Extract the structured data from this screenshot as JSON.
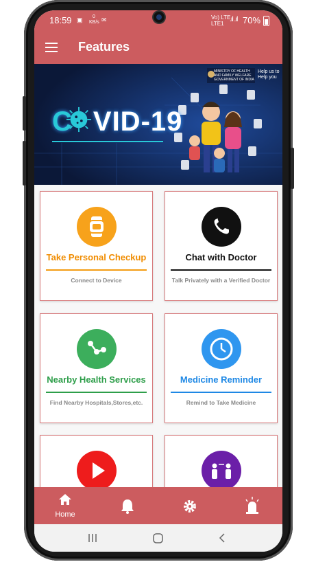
{
  "status_bar": {
    "time": "18:59",
    "network_top": "Vo) LTE",
    "network_bottom": "LTE1",
    "speed": "0 KB/s",
    "battery": "70%"
  },
  "app_bar": {
    "title": "Features",
    "menu_icon": "hamburger-menu-icon"
  },
  "banner": {
    "headline_prefix": "C",
    "headline_suffix": "VID-19",
    "ministry": "MINISTRY OF HEALTH AND FAMILY WELFARE GOVERNMENT OF INDIA",
    "help_text": "Help us to Help you"
  },
  "features": [
    {
      "title": "Take Personal Checkup",
      "subtitle": "Connect to Device",
      "icon": "smartwatch-icon",
      "color": "#f7a21b",
      "title_color": "#f08c00",
      "line_color": "#f39c12"
    },
    {
      "title": "Chat with Doctor",
      "subtitle": "Talk Privately with a Verified Doctor",
      "icon": "phone-icon",
      "color": "#111111",
      "title_color": "#111111",
      "line_color": "#111111"
    },
    {
      "title": "Nearby Health Services",
      "subtitle": "Find Nearby Hospitals,Stores,etc.",
      "icon": "share-nodes-icon",
      "color": "#3cae5c",
      "title_color": "#2e9e4a",
      "line_color": "#2e9e4a"
    },
    {
      "title": "Medicine Reminder",
      "subtitle": "Remind to Take Medicine",
      "icon": "clock-icon",
      "color": "#2f96ef",
      "title_color": "#1e88e5",
      "line_color": "#1e88e5"
    },
    {
      "title": "",
      "subtitle": "",
      "icon": "play-icon",
      "color": "#ee1c1c",
      "title_color": "#ee1c1c",
      "line_color": "#ee1c1c"
    },
    {
      "title": "",
      "subtitle": "",
      "icon": "social-distance-icon",
      "color": "#6b1fa8",
      "title_color": "#6b1fa8",
      "line_color": "#6b1fa8"
    }
  ],
  "bottom_nav": [
    {
      "label": "Home",
      "icon": "home-icon"
    },
    {
      "label": "",
      "icon": "bell-icon"
    },
    {
      "label": "",
      "icon": "gear-icon"
    },
    {
      "label": "",
      "icon": "emergency-siren-icon"
    }
  ],
  "system_nav": {
    "icons": [
      "recents-icon",
      "home-circle-icon",
      "back-icon"
    ]
  },
  "colors": {
    "primary": "#cc5c5f",
    "card_border": "#d77a7c"
  }
}
